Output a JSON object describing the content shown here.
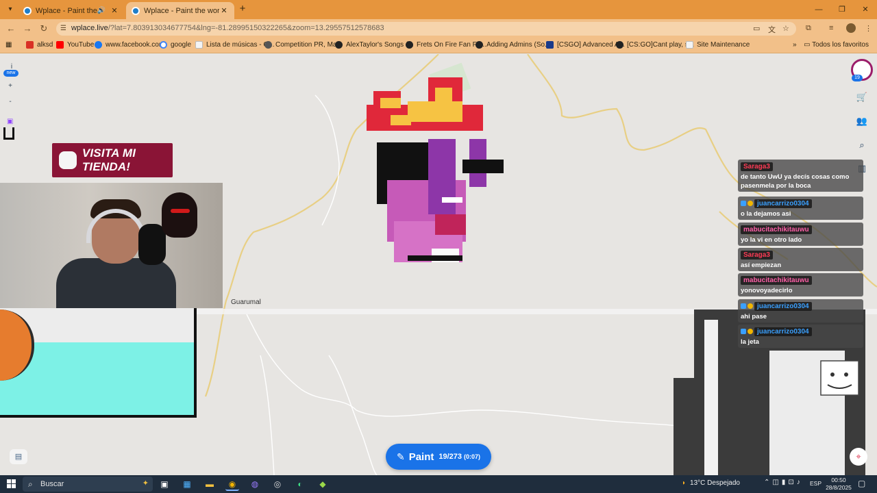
{
  "browser": {
    "tabs": [
      {
        "title": "Wplace - Paint the wo",
        "muted_icon": "speaker-icon"
      },
      {
        "title": "Wplace - Paint the world"
      }
    ],
    "url_host": "wplace.live",
    "url_path": "/?lat=7.803913034677754&lng=-81.28995150322265&zoom=13.29557512578683",
    "bookmarks": [
      {
        "label": "alksd",
        "icon": "gmail-icon",
        "color": "#d93025"
      },
      {
        "label": "YouTube",
        "icon": "youtube-icon",
        "color": "#ff0000"
      },
      {
        "label": "www.facebook.com",
        "icon": "facebook-icon",
        "color": "#1877f2"
      },
      {
        "label": "google",
        "icon": "google-icon",
        "color": "#4285f4"
      },
      {
        "label": "Lista de músicas - G...",
        "icon": "page-icon",
        "color": "#f4f4f4"
      },
      {
        "label": "Competition PR, Ma...",
        "icon": "page-icon",
        "color": "#555555"
      },
      {
        "label": "AlexTaylor's Songs (...",
        "icon": "page-icon",
        "color": "#222222"
      },
      {
        "label": "Frets On Fire Fan Fo...",
        "icon": "page-icon",
        "color": "#222222"
      },
      {
        "label": "Adding Admins (So...",
        "icon": "page-icon",
        "color": "#222222"
      },
      {
        "label": "[CSGO] Advanced A...",
        "icon": "folder-icon",
        "color": "#1a3a8a"
      },
      {
        "label": "[CS:GO]Cant play, s...",
        "icon": "page-icon",
        "color": "#222222"
      },
      {
        "label": "Site Maintenance",
        "icon": "page-icon",
        "color": "#f4f4f4"
      }
    ],
    "all_bookmarks": "Todos los favoritos"
  },
  "map": {
    "place_label": "Guarumal",
    "new_badge": "new",
    "left_tools": [
      "i",
      "+",
      "-"
    ],
    "user_badge_count": "19",
    "store_banner": "VISITA MI TIENDA!"
  },
  "chat": [
    {
      "user": "Saraga3",
      "user_color": "red",
      "text": "de tanto UwU ya decís cosas como pasenmela por la boca"
    },
    {
      "user": "juancarrizo0304",
      "user_color": "blue",
      "text": "o la dejamos asi"
    },
    {
      "user": "mabucitachikitauwu",
      "user_color": "pink",
      "text": "yo la vi en otro lado"
    },
    {
      "user": "Saraga3",
      "user_color": "red",
      "text": "así empiezan"
    },
    {
      "user": "mabucitachikitauwu",
      "user_color": "pink",
      "text": "yonovoyadecirlo"
    },
    {
      "user": "juancarrizo0304",
      "user_color": "blue",
      "text": "ahi pase"
    },
    {
      "user": "juancarrizo0304",
      "user_color": "blue",
      "text": "la jeta"
    }
  ],
  "paint_button": {
    "label": "Paint",
    "count": "19/273",
    "timer": "(0:07)"
  },
  "taskbar": {
    "search_placeholder": "Buscar",
    "weather": "13°C  Despejado",
    "language": "ESP",
    "time": "00:50",
    "date": "28/8/2025"
  }
}
